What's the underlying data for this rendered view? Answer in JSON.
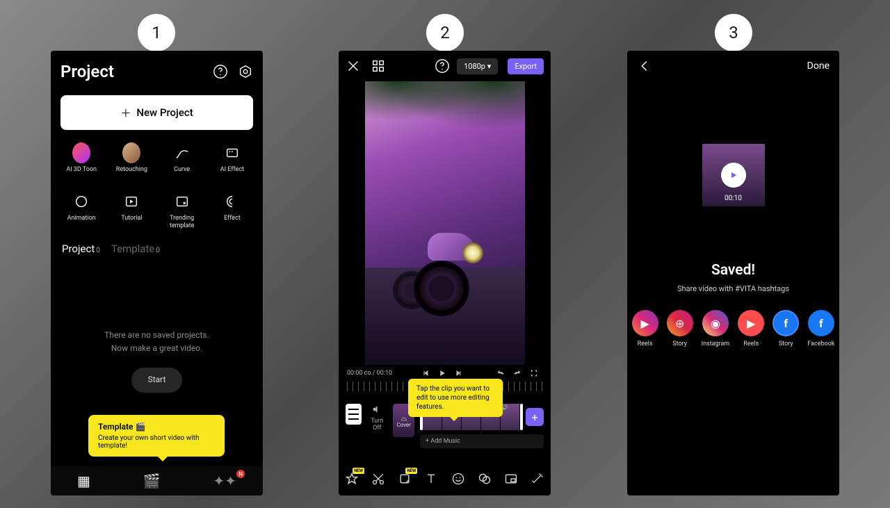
{
  "steps": [
    "1",
    "2",
    "3"
  ],
  "screen1": {
    "title": "Project",
    "new_project": "New Project",
    "tools": [
      {
        "label": "AI 3D Toon"
      },
      {
        "label": "Retouching"
      },
      {
        "label": "Curve"
      },
      {
        "label": "AI Effect"
      },
      {
        "label": "Animation"
      },
      {
        "label": "Tutorial"
      },
      {
        "label": "Trending template"
      },
      {
        "label": "Effect"
      }
    ],
    "tabs": {
      "project": "Project",
      "project_count": "0",
      "template": "Template",
      "template_count": "0"
    },
    "empty1": "There are no saved projects.",
    "empty2": "Now make a great video.",
    "start": "Start",
    "tip_title": "Template 🎬",
    "tip_body": "Create your own short video with template!",
    "bottom_badge": "N"
  },
  "screen2": {
    "resolution": "1080p ▾",
    "export": "Export",
    "time": "00:00 co / 00:10",
    "tip": "Tap the clip you want to edit to use more editing features.",
    "turnoff": "Turn Off",
    "cover": "Cover",
    "add_music": "+  Add Music",
    "new_tag": "NEW"
  },
  "screen3": {
    "done": "Done",
    "duration": "00:10",
    "saved": "Saved!",
    "subtitle": "Share video with #VITA hashtags",
    "shares": [
      {
        "label": "Reels"
      },
      {
        "label": "Story"
      },
      {
        "label": "Instagram"
      },
      {
        "label": "Reels"
      },
      {
        "label": "Story"
      },
      {
        "label": "Facebook"
      }
    ]
  }
}
